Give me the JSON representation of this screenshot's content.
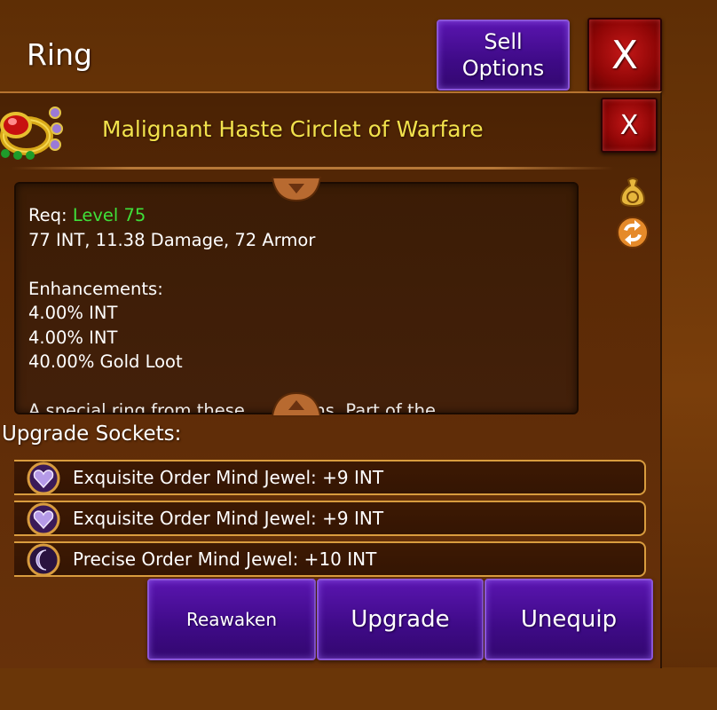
{
  "header": {
    "title": "Ring",
    "sell_line1": "Sell",
    "sell_line2": "Options",
    "close_label": "X"
  },
  "item": {
    "name": "Malignant Haste Circlet of Warfare",
    "close_label": "X",
    "req_label": "Req:",
    "req_value": "Level 75",
    "stats": "77 INT, 11.38 Damage, 72 Armor",
    "enhancements_label": "Enhancements:",
    "enhancements": [
      "4.00% INT",
      "4.00% INT",
      "40.00% Gold Loot"
    ],
    "description_partial": "A special ring from these ... goblins. Part of the"
  },
  "sockets": {
    "label": "Upgrade Sockets:",
    "items": [
      {
        "text": "Exquisite Order Mind Jewel: +9 INT",
        "icon": "heart-gem-icon"
      },
      {
        "text": "Exquisite Order Mind Jewel: +9 INT",
        "icon": "heart-gem-icon"
      },
      {
        "text": "Precise Order Mind Jewel: +10 INT",
        "icon": "crescent-gem-icon"
      }
    ]
  },
  "actions": {
    "reawaken": "Reawaken",
    "upgrade": "Upgrade",
    "unequip": "Unequip"
  },
  "colors": {
    "title_yellow": "#f2e24c",
    "level_green": "#3fe03a",
    "button_purple": "#4a10a0",
    "close_red": "#b31212",
    "socket_border": "#d99c3e"
  },
  "side_icons": [
    "gold-bag-icon",
    "swap-arrows-icon"
  ]
}
